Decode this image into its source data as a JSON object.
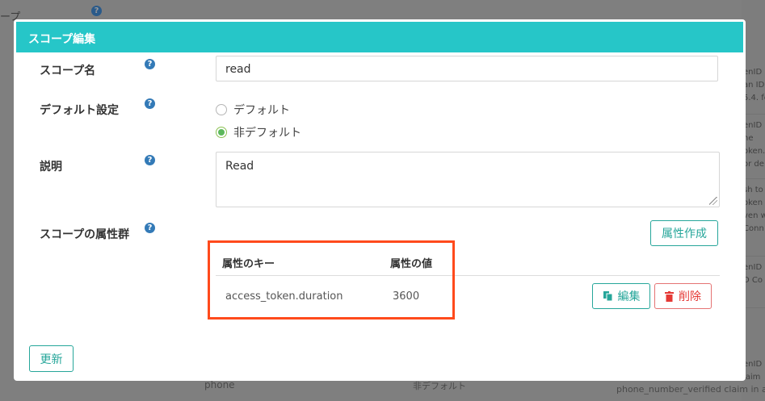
{
  "background": {
    "side_label": "ープ",
    "bottom_name": "phone",
    "bottom_scope_type": "非デフォルト",
    "bottom_claim_desc": "phone_number_verified claim in an",
    "right_snippets": [
      "enID",
      "an ID",
      "5.4. fo",
      "enID",
      "he",
      "oken.",
      "or de",
      "sh to",
      "oken",
      "ven w",
      "Conn",
      "enID",
      "D Co",
      "enID",
      "laim"
    ]
  },
  "modal": {
    "title": "スコープ編集",
    "scope_name": {
      "label": "スコープ名",
      "value": "read"
    },
    "default_setting": {
      "label": "デフォルト設定",
      "options": [
        {
          "label": "デフォルト",
          "selected": false
        },
        {
          "label": "非デフォルト",
          "selected": true
        }
      ]
    },
    "description": {
      "label": "説明",
      "value": "Read"
    },
    "attributes": {
      "label": "スコープの属性群",
      "create_button": "属性作成",
      "columns": [
        "属性のキー",
        "属性の値"
      ],
      "rows": [
        {
          "key": "access_token.duration",
          "value": "3600",
          "edit_label": "編集",
          "delete_label": "削除"
        }
      ]
    },
    "update_button": "更新",
    "help_glyph": "?"
  },
  "colors": {
    "header": "#26c6c8",
    "accent": "#26a69a",
    "danger": "#e53935",
    "highlight": "#ff4a1c"
  }
}
